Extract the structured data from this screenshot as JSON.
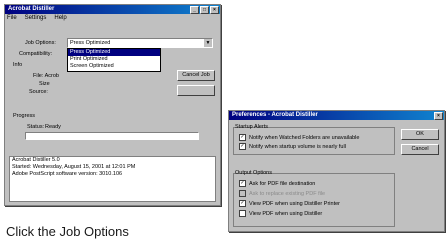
{
  "distiller": {
    "title": "Acrobat Distiller",
    "menu": [
      "File",
      "Settings",
      "Help"
    ],
    "job_options_label": "Job Options:",
    "job_options_value": "Press Optimized",
    "dropdown_options": [
      "Press Optimized",
      "Print Optimized",
      "Screen Optimized"
    ],
    "compatibility_label": "Compatibility:",
    "info_label": "Info",
    "file_label": "File: Acrob",
    "size_label": "Size",
    "source_label": "Source:",
    "cancel_label": "Cancel Job",
    "progress_label": "Progress",
    "status_label": "Status:",
    "status_value": "Ready",
    "log_lines": [
      "Acrobat Distiller 5.0",
      "Started: Wednesday, August 15, 2001 at 12:01 PM",
      "",
      "Adobe PostScript software version: 3010.106"
    ]
  },
  "prefs": {
    "title": "Preferences - Acrobat Distiller",
    "startup_label": "Startup Alerts",
    "startup_items": [
      {
        "label": "Notify when Watched Folders are unavailable",
        "checked": true
      },
      {
        "label": "Notify when startup volume is nearly full",
        "checked": true
      }
    ],
    "output_label": "Output Options",
    "output_items": [
      {
        "label": "Ask for PDF file destination",
        "checked": true,
        "disabled": false
      },
      {
        "label": "Ask to replace existing PDF file",
        "checked": false,
        "disabled": true
      },
      {
        "label": "View PDF when using Distiller Printer",
        "checked": true,
        "disabled": false
      },
      {
        "label": "View PDF when using Distiller",
        "checked": false,
        "disabled": false
      }
    ],
    "ok_label": "OK",
    "cancel_label": "Cancel"
  },
  "caption": "Click the Job Options"
}
